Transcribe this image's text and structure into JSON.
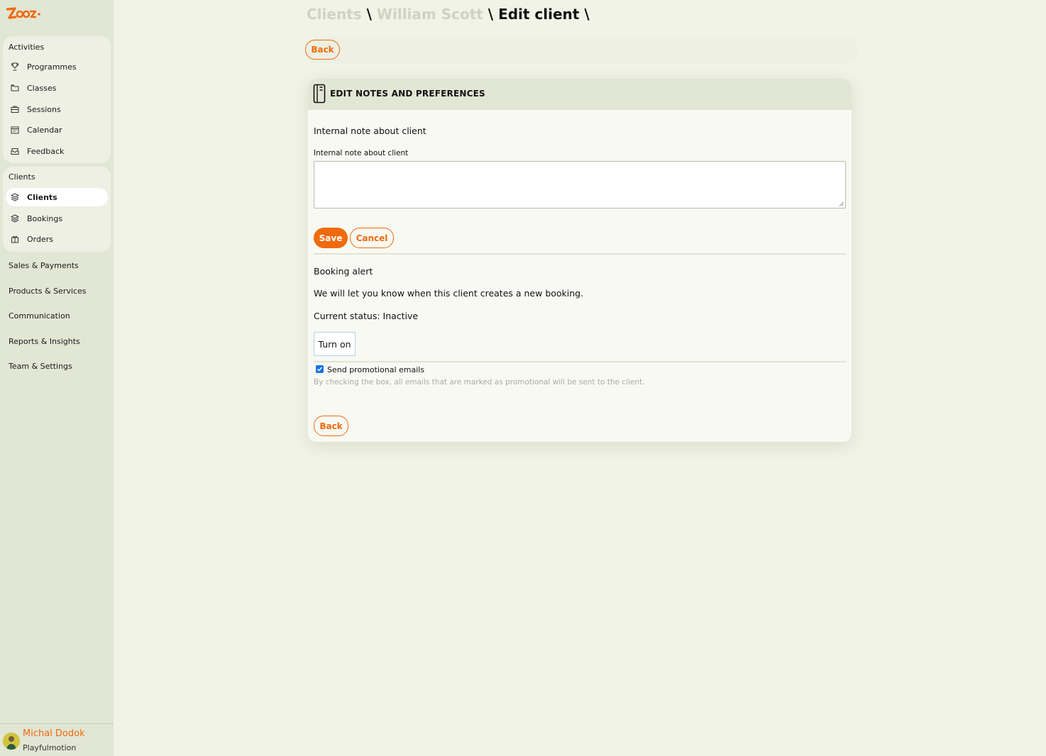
{
  "sidebar": {
    "logo_alt": "Zooza",
    "groups": [
      {
        "title": "Activities",
        "items": [
          {
            "label": "Programmes",
            "icon": "trophy-icon"
          },
          {
            "label": "Classes",
            "icon": "folder-icon"
          },
          {
            "label": "Sessions",
            "icon": "briefcase-icon"
          },
          {
            "label": "Calendar",
            "icon": "calendar-icon"
          },
          {
            "label": "Feedback",
            "icon": "inbox-icon"
          }
        ]
      },
      {
        "title": "Clients",
        "items": [
          {
            "label": "Clients",
            "icon": "clients-icon",
            "active": true
          },
          {
            "label": "Bookings",
            "icon": "layers-icon"
          },
          {
            "label": "Orders",
            "icon": "gift-icon"
          }
        ]
      }
    ],
    "links": [
      "Sales & Payments",
      "Products & Services",
      "Communication",
      "Reports & Insights",
      "Team & Settings"
    ],
    "user": {
      "name": "Michal Dodok",
      "org": "Playfulmotion"
    }
  },
  "breadcrumb": {
    "items": [
      "Clients",
      "William Scott",
      "Edit client"
    ],
    "separator": "\\"
  },
  "toolbar": {
    "back_label": "Back"
  },
  "card": {
    "title": "EDIT NOTES AND PREFERENCES",
    "note": {
      "section_title": "Internal note about client",
      "field_label": "Internal note about client",
      "value": "",
      "save_label": "Save",
      "cancel_label": "Cancel"
    },
    "alert": {
      "section_title": "Booking alert",
      "description": "We will let you know when this client creates a new booking.",
      "status": "Current status: Inactive",
      "toggle_label": "Turn on"
    },
    "promo": {
      "checked": true,
      "label": "Send promotional emails",
      "help": "By checking the box, all emails that are marked as promotional will be sent to the client."
    },
    "back_label": "Back"
  },
  "colors": {
    "accent": "#f06a0e",
    "sidebar_bg": "#e2e6d4",
    "page_bg": "#f1f3e6"
  }
}
